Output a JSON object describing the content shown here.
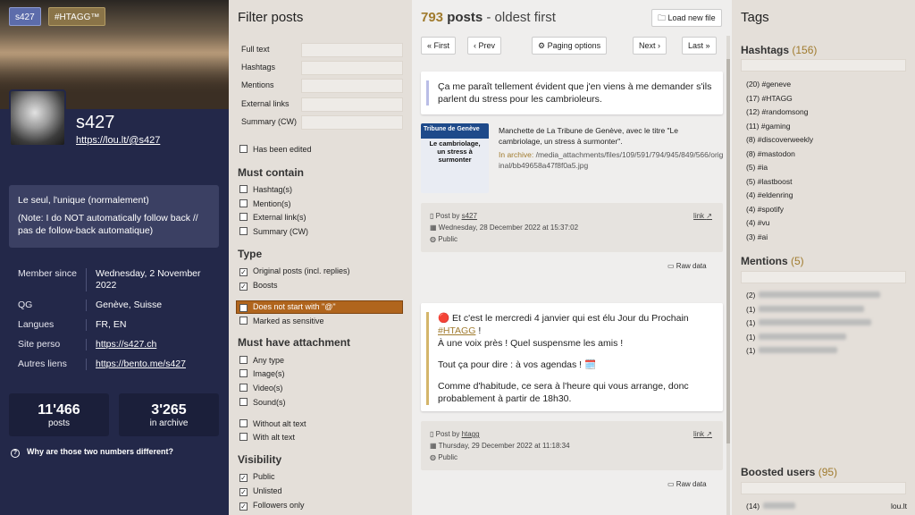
{
  "header": {
    "tab1": "s427",
    "tab2": "#HTAGG™"
  },
  "profile": {
    "name": "s427",
    "link": "https://lou.lt/@s427",
    "bio": [
      "Le seul, l'unique (normalement)",
      "(Note: I do NOT automatically follow back // pas de follow-back automatique)"
    ],
    "fields": [
      {
        "k": "Member since",
        "v": "Wednesday, 2 November 2022"
      },
      {
        "k": "QG",
        "v": "Genève, Suisse"
      },
      {
        "k": "Langues",
        "v": "FR, EN"
      },
      {
        "k": "Site perso",
        "v": "https://s427.ch"
      },
      {
        "k": "Autres liens",
        "v": "https://bento.me/s427"
      }
    ],
    "posts_count": "11'466",
    "posts_label": "posts",
    "archive_count": "3'265",
    "archive_label": "in archive",
    "why": "Why are those two numbers different?"
  },
  "filter": {
    "title": "Filter posts",
    "fields": [
      "Full text",
      "Hashtags",
      "Mentions",
      "External links",
      "Summary (CW)"
    ],
    "edited": "Has been edited",
    "must_contain": "Must contain",
    "contain_items": [
      "Hashtag(s)",
      "Mention(s)",
      "External link(s)",
      "Summary (CW)"
    ],
    "type": "Type",
    "type_items": [
      "Original posts (incl. replies)",
      "Boosts"
    ],
    "not_start": "Does not start with \"@\"",
    "sensitive": "Marked as sensitive",
    "attachment": "Must have attachment",
    "attach_items": [
      "Any type",
      "Image(s)",
      "Video(s)",
      "Sound(s)"
    ],
    "alt_items": [
      "Without alt text",
      "With alt text"
    ],
    "visibility": "Visibility",
    "vis_items": [
      "Public",
      "Unlisted",
      "Followers only"
    ]
  },
  "main": {
    "count": "793",
    "posts_word": "posts",
    "sort": " - oldest first",
    "load": "Load new file",
    "first": "First",
    "prev": "Prev",
    "paging": "Paging options",
    "next": "Next",
    "last": "Last",
    "post1": {
      "text": "Ça me paraît tellement évident que j'en viens à me demander s'ils parlent du stress pour les cambrioleurs.",
      "caption": "Manchette de La Tribune de Genève, avec le titre \"Le cambriolage, un stress à surmonter\".",
      "archive_label": "In archive:",
      "archive_path": "/media_attachments/files/109/591/794/945/849/566/original/bb49658a47f8f0a5.jpg",
      "img_title": "Tribune de Genève",
      "img_text": "Le cambriolage, un stress à surmonter",
      "by": "Post by",
      "author": "s427",
      "date": "Wednesday, 28 December 2022 at 15:37:02",
      "vis": "Public",
      "link": "link",
      "raw": "Raw data"
    },
    "post2": {
      "line1a": "🔴 Et c'est le mercredi 4 janvier qui est élu Jour du Prochain",
      "tag": "#HTAGG",
      "line1b": " !",
      "line2": "À une voix près ! Quel suspensme les amis !",
      "line3": "Tout ça pour dire : à vos agendas ! 🗓️",
      "line4": "Comme d'habitude, ce sera à l'heure qui vous arrange, donc probablement à partir de 18h30.",
      "by": "Post by",
      "author": "htagg",
      "date": "Thursday, 29 December 2022 at 11:18:34",
      "vis": "Public",
      "link": "link",
      "raw": "Raw data"
    }
  },
  "tags": {
    "title": "Tags",
    "hashtags_label": "Hashtags",
    "hashtags_count": "(156)",
    "hashtags": [
      "(20) #geneve",
      "(17) #HTAGG",
      "(12) #randomsong",
      "(11) #gaming",
      "(8) #discoverweekly",
      "(8) #mastodon",
      "(5) #ia",
      "(5) #lastboost",
      "(4) #eldenring",
      "(4) #spotify",
      "(4) #vu",
      "(3) #ai"
    ],
    "mentions_label": "Mentions",
    "mentions_count": "(5)",
    "mentions": [
      "(2)",
      "(1)",
      "(1)",
      "(1)",
      "(1)"
    ],
    "boosted_label": "Boosted users",
    "boosted_count": "(95)",
    "boosted_first": "(14)",
    "boosted_domain": "lou.lt"
  }
}
